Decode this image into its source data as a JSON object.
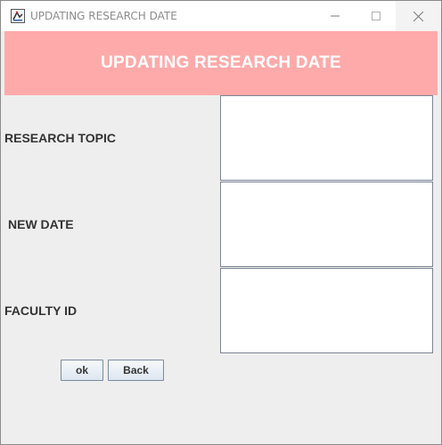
{
  "window": {
    "title": "UPDATING RESEARCH DATE",
    "controls": {
      "minimize": "minimize-icon",
      "maximize": "maximize-icon",
      "close": "close-icon"
    }
  },
  "header": {
    "title": "UPDATING RESEARCH DATE",
    "background_color": "#ffaaaa",
    "text_color": "#ffffff"
  },
  "form": {
    "fields": [
      {
        "label": "RESEARCH TOPIC",
        "value": ""
      },
      {
        "label": "NEW DATE",
        "value": ""
      },
      {
        "label": "FACULTY ID",
        "value": ""
      }
    ]
  },
  "buttons": {
    "ok_label": "ok",
    "back_label": "Back"
  }
}
